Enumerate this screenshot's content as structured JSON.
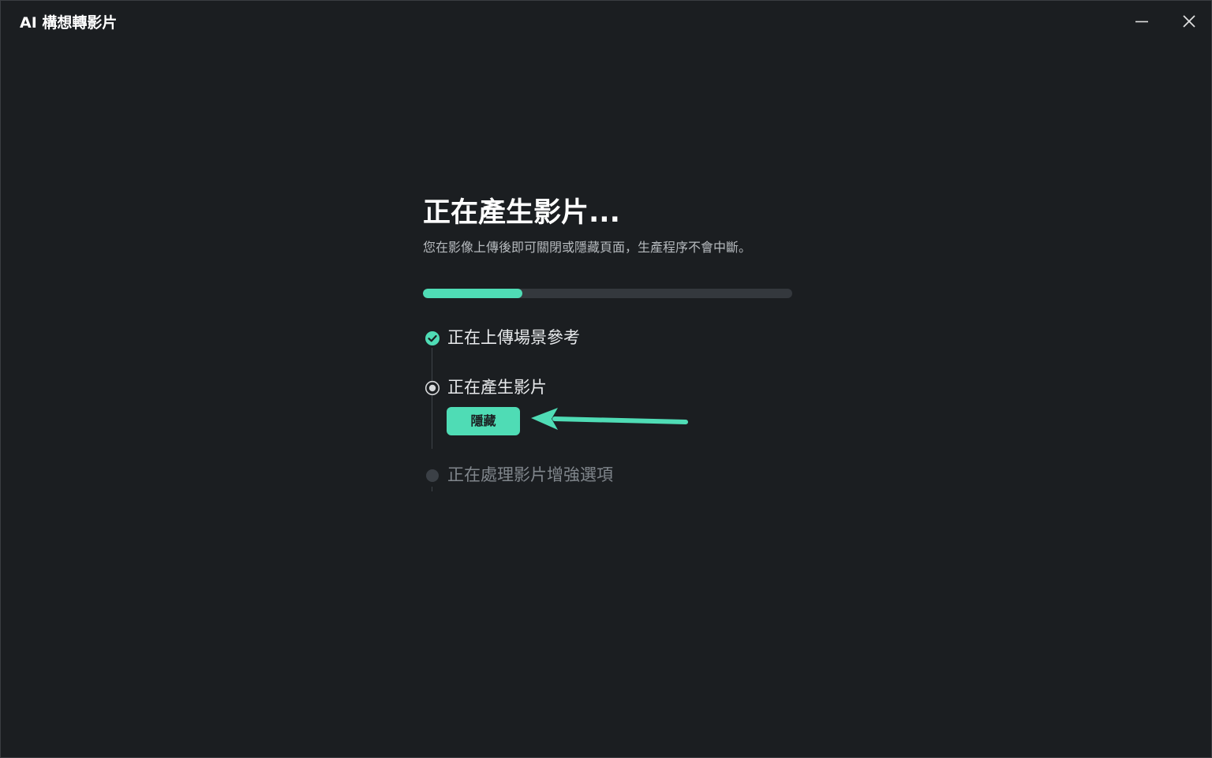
{
  "window": {
    "title": "AI 構想轉影片",
    "controls": {
      "minimize_icon": "minimize-icon",
      "close_icon": "close-icon"
    }
  },
  "main": {
    "heading": "正在產生影片...",
    "subtitle": "您在影像上傳後即可關閉或隱藏頁面，生產程序不會中斷。",
    "progress": 0.27
  },
  "steps": [
    {
      "label": "正在上傳場景參考",
      "status": "done",
      "icon": "check-circle-icon"
    },
    {
      "label": "正在產生影片",
      "status": "active",
      "icon": "radio-active-icon"
    },
    {
      "label": "正在處理影片增強選項",
      "status": "pending",
      "icon": "dot-pending-icon"
    }
  ],
  "hide_button": {
    "label": "隱藏"
  },
  "annotation": {
    "icon": "arrow-left-icon",
    "color": "#4fdcb5"
  },
  "colors": {
    "accent": "#4fdcb5",
    "background": "#1b1e21",
    "track": "#34383d"
  }
}
